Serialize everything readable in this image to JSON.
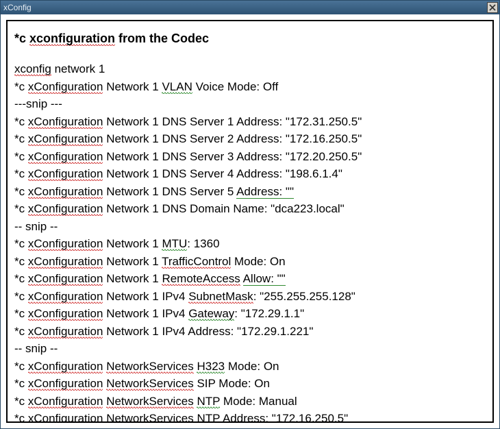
{
  "window": {
    "title": "xConfig"
  },
  "heading": {
    "prefix": "*c ",
    "xcfg": "xconfiguration",
    "suffix": " from the Codec"
  },
  "rows": [
    {
      "seg": [
        {
          "t": "xconfig",
          "cls": "sq-red"
        },
        {
          "t": " network 1"
        }
      ]
    },
    {
      "seg": [
        {
          "t": "*c "
        },
        {
          "t": "xConfiguration",
          "cls": "sq-red"
        },
        {
          "t": " Network 1 "
        },
        {
          "t": "VLAN",
          "cls": "sq-green"
        },
        {
          "t": " Voice Mode: Off"
        }
      ]
    },
    {
      "seg": [
        {
          "t": "---snip ---"
        }
      ]
    },
    {
      "seg": [
        {
          "t": "*c "
        },
        {
          "t": "xConfiguration",
          "cls": "sq-red"
        },
        {
          "t": " Network 1 DNS Server 1 Address: \"172.31.250.5\""
        }
      ]
    },
    {
      "seg": [
        {
          "t": "*c "
        },
        {
          "t": "xConfiguration",
          "cls": "sq-red"
        },
        {
          "t": " Network 1 DNS Server 2 Address: \"172.16.250.5\""
        }
      ]
    },
    {
      "seg": [
        {
          "t": "*c "
        },
        {
          "t": "xConfiguration",
          "cls": "sq-red"
        },
        {
          "t": " Network 1 DNS Server 3 Address: \"172.20.250.5\""
        }
      ]
    },
    {
      "seg": [
        {
          "t": "*c "
        },
        {
          "t": "xConfiguration",
          "cls": "sq-red"
        },
        {
          "t": " Network 1 DNS Server 4 Address: \"198.6.1.4\""
        }
      ]
    },
    {
      "seg": [
        {
          "t": "*c "
        },
        {
          "t": "xConfiguration",
          "cls": "sq-red"
        },
        {
          "t": " Network 1 DNS Server 5 "
        },
        {
          "t": "Address: \"\"",
          "cls": "ul-green"
        }
      ]
    },
    {
      "seg": [
        {
          "t": "*c "
        },
        {
          "t": "xConfiguration",
          "cls": "sq-red"
        },
        {
          "t": " Network 1 DNS Domain Name: \"dca223.local\""
        }
      ]
    },
    {
      "seg": [
        {
          "t": "-- snip --"
        }
      ]
    },
    {
      "seg": [
        {
          "t": "*c "
        },
        {
          "t": "xConfiguration",
          "cls": "sq-red"
        },
        {
          "t": " Network 1 "
        },
        {
          "t": "MTU",
          "cls": "sq-green"
        },
        {
          "t": ": 1360"
        }
      ]
    },
    {
      "seg": [
        {
          "t": "*c "
        },
        {
          "t": "xConfiguration",
          "cls": "sq-red"
        },
        {
          "t": " Network 1 "
        },
        {
          "t": "TrafficControl",
          "cls": "sq-red"
        },
        {
          "t": " Mode: On"
        }
      ]
    },
    {
      "seg": [
        {
          "t": "*c "
        },
        {
          "t": "xConfiguration",
          "cls": "sq-red"
        },
        {
          "t": " Network 1 "
        },
        {
          "t": "RemoteAccess",
          "cls": "sq-red"
        },
        {
          "t": " "
        },
        {
          "t": "Allow: \"\"",
          "cls": "ul-green"
        }
      ]
    },
    {
      "seg": [
        {
          "t": "*c "
        },
        {
          "t": "xConfiguration",
          "cls": "sq-red"
        },
        {
          "t": " Network 1 IPv4 "
        },
        {
          "t": "SubnetMask",
          "cls": "sq-red"
        },
        {
          "t": ": \"255.255.255.128\""
        }
      ]
    },
    {
      "seg": [
        {
          "t": "*c "
        },
        {
          "t": "xConfiguration",
          "cls": "sq-red"
        },
        {
          "t": " Network 1 IPv4 "
        },
        {
          "t": "Gateway",
          "cls": "sq-green"
        },
        {
          "t": ": \"172.29.1.1\""
        }
      ]
    },
    {
      "seg": [
        {
          "t": "*c "
        },
        {
          "t": "xConfiguration",
          "cls": "sq-red"
        },
        {
          "t": " Network 1 IPv4 Address: \"172.29.1.221\""
        }
      ]
    },
    {
      "seg": [
        {
          "t": "-- snip --"
        }
      ]
    },
    {
      "seg": [
        {
          "t": "*c "
        },
        {
          "t": "xConfiguration",
          "cls": "sq-red"
        },
        {
          "t": " "
        },
        {
          "t": "NetworkServices",
          "cls": "sq-red"
        },
        {
          "t": " "
        },
        {
          "t": "H323",
          "cls": "sq-green"
        },
        {
          "t": " Mode: On"
        }
      ]
    },
    {
      "seg": [
        {
          "t": "*c "
        },
        {
          "t": "xConfiguration",
          "cls": "sq-red"
        },
        {
          "t": " "
        },
        {
          "t": "NetworkServices",
          "cls": "sq-red"
        },
        {
          "t": " SIP Mode: On"
        }
      ]
    },
    {
      "seg": [
        {
          "t": "*c "
        },
        {
          "t": "xConfiguration",
          "cls": "sq-red"
        },
        {
          "t": " "
        },
        {
          "t": "NetworkServices",
          "cls": "sq-red"
        },
        {
          "t": " "
        },
        {
          "t": "NTP",
          "cls": "sq-green"
        },
        {
          "t": " Mode: Manual"
        }
      ]
    },
    {
      "seg": [
        {
          "t": "*c "
        },
        {
          "t": "xConfiguration",
          "cls": "sq-red"
        },
        {
          "t": " "
        },
        {
          "t": "NetworkServices",
          "cls": "sq-red"
        },
        {
          "t": " "
        },
        {
          "t": "NTP",
          "cls": "sq-green"
        },
        {
          "t": " Address: \"172.16.250.5\""
        }
      ]
    }
  ]
}
